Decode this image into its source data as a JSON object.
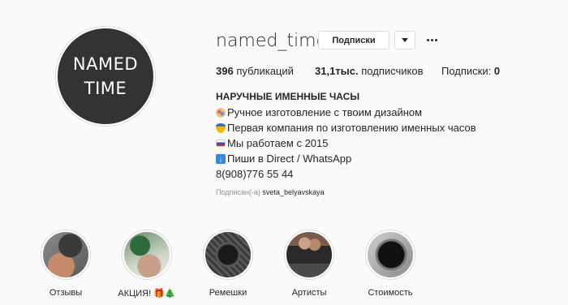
{
  "profile": {
    "avatar_line1": "NAMED",
    "avatar_line2": "TIME",
    "username": "named_time",
    "follow_button": "Подписки",
    "more_icon": "ellipsis-icon",
    "dropdown_icon": "chevron-down-icon"
  },
  "stats": {
    "posts_count": "396",
    "posts_label": "публикаций",
    "followers_count": "31,1тыс.",
    "followers_label": "подписчиков",
    "following_label": "Подписки:",
    "following_count": "0"
  },
  "bio": {
    "title": "НАРУЧНЫЕ ИМЕННЫЕ ЧАСЫ",
    "line1": "Ручное изготовление с твоим дизайном",
    "line2": "Первая компания по изготовлению именных часов",
    "line3": "Мы работаем с 2015",
    "line4": "Пиши в Direct / WhatsApp",
    "phone": "8(908)776 55 44",
    "followed_prefix": "Подписан(-а)",
    "followed_by": "sveta_belyavskaya"
  },
  "highlights": [
    {
      "label": "Отзывы"
    },
    {
      "label": "АКЦИЯ! 🎁🎄"
    },
    {
      "label": "Ремешки"
    },
    {
      "label": "Артисты"
    },
    {
      "label": "Стоимость"
    }
  ]
}
